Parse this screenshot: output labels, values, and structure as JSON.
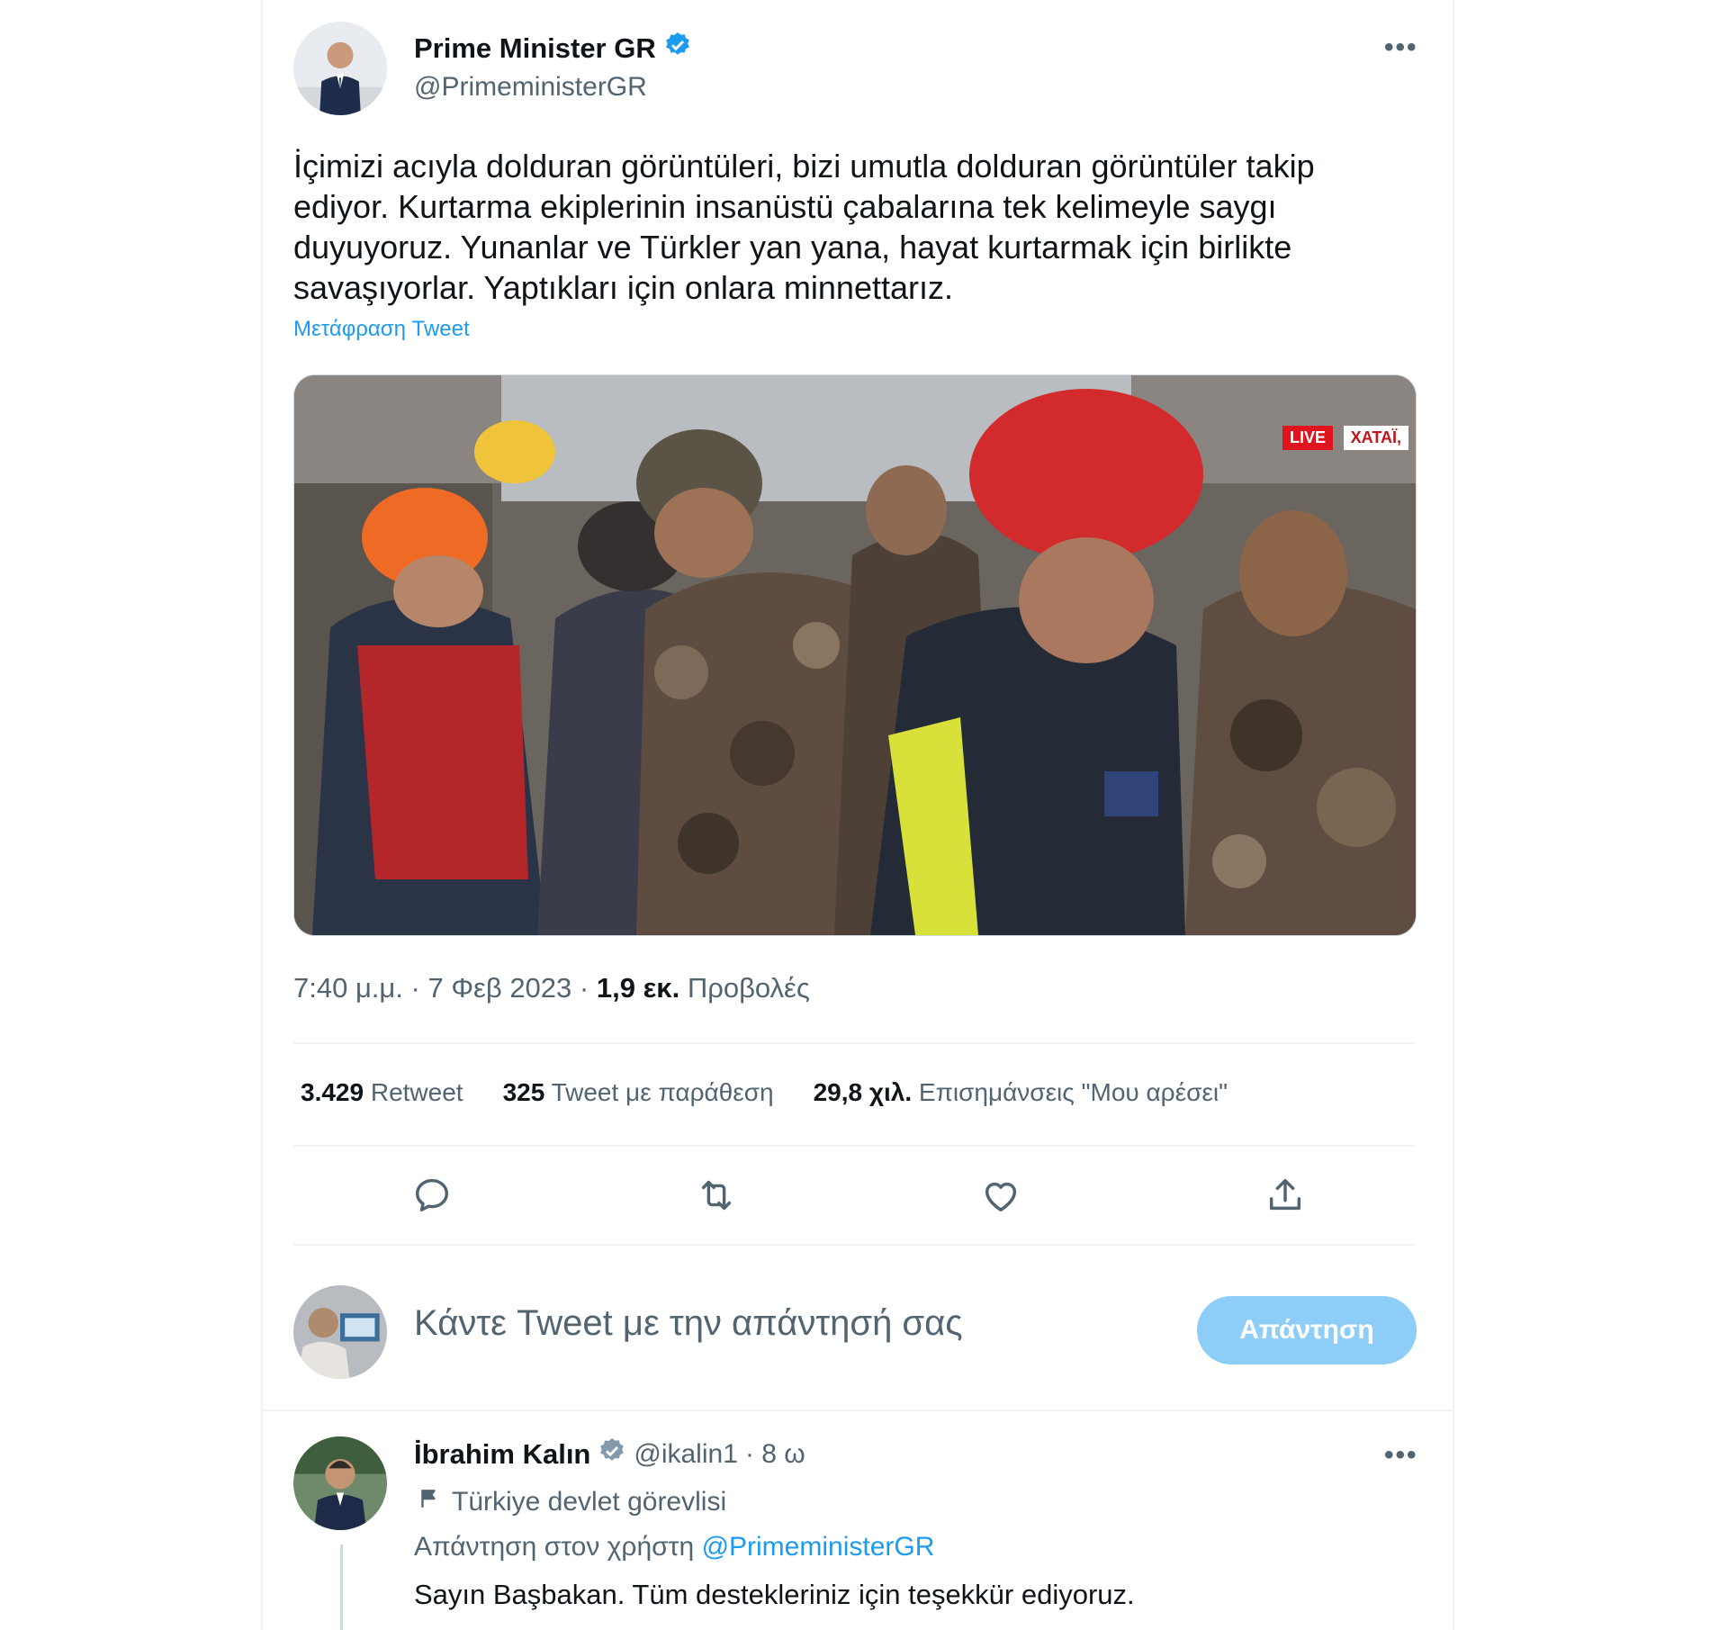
{
  "tweet": {
    "author_name": "Prime Minister GR",
    "author_handle": "@PrimeministerGR",
    "more_icon": "more-icon",
    "text_lines": [
      "İçimizi acıyla dolduran görüntüleri, bizi umutla dolduran görüntüler takip",
      "ediyor.  Kurtarma ekiplerinin insanüstü çabalarına tek kelimeyle saygı",
      "duyuyoruz. Yunanlar ve Türkler yan yana, hayat kurtarmak için birlikte",
      "savaşıyorlar. Yaptıkları için onlara minnettarız."
    ],
    "translate_label": "Μετάφραση Tweet",
    "media": {
      "live_label": "LIVE",
      "location_label": "XATAÏ,"
    },
    "time": "7:40 μ.μ.",
    "date": "7 Φεβ 2023",
    "views_count": "1,9 εκ.",
    "views_label": "Προβολές",
    "stats": {
      "retweets_count": "3.429",
      "retweets_label": "Retweet",
      "quotes_count": "325",
      "quotes_label": "Tweet με παράθεση",
      "likes_count": "29,8 χιλ.",
      "likes_label": "Επισημάνσεις \"Μου αρέσει\""
    },
    "actions": [
      "reply-icon",
      "retweet-icon",
      "like-icon",
      "share-icon"
    ]
  },
  "composer": {
    "placeholder": "Κάντε Tweet με την απάντησή σας",
    "button_label": "Απάντηση",
    "button_color": "#8ecdf8"
  },
  "reply": {
    "author_name": "İbrahim Kalın",
    "author_handle": "@ikalin1",
    "time": "· 8 ω",
    "label": "Türkiye devlet görevlisi",
    "reply_prefix": "Απάντηση στον χρήστη",
    "mention": "@PrimeministerGR",
    "text": "Sayın Başbakan. Tüm destekleriniz için teşekkür ediyoruz."
  },
  "colors": {
    "accent": "#1d9bf0",
    "verified": "#1d9bf0",
    "verified_gray": "#829aab",
    "secondary_text": "#536471"
  }
}
